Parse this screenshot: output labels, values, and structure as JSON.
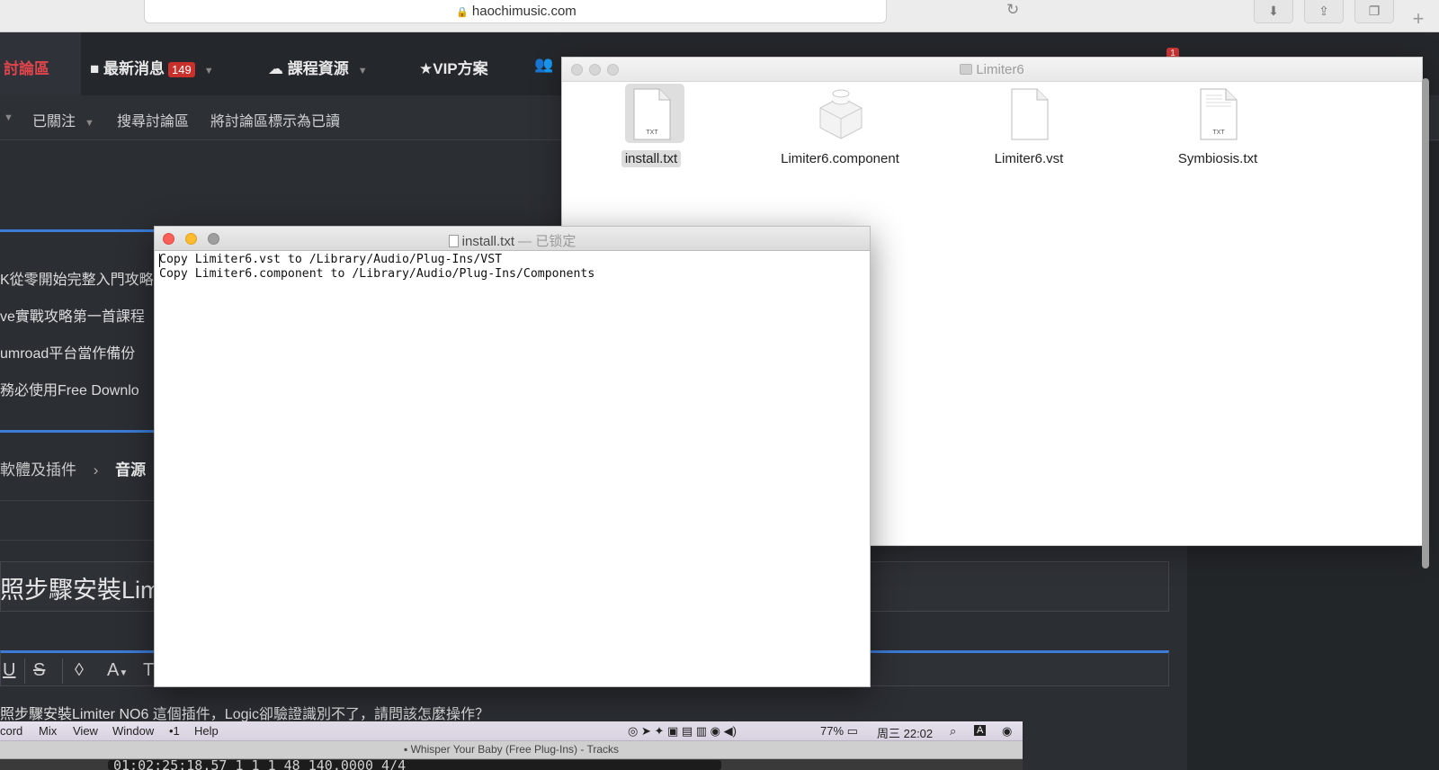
{
  "browser": {
    "url": "haochimusic.com",
    "lock_icon": "lock-icon",
    "reload_icon": "reload-icon",
    "toolbar_icons": [
      "download-icon",
      "share-icon",
      "tabs-overview-icon",
      "new-tab-icon"
    ],
    "new_tab_label": "+"
  },
  "site_nav": {
    "items": [
      {
        "label": "討論區",
        "icon": ""
      },
      {
        "label": "最新消息",
        "icon": "alert-icon",
        "badge": "149"
      },
      {
        "label": "課程資源",
        "icon": "cloud-download-icon"
      },
      {
        "label": "VIP方案",
        "icon": "star-icon"
      }
    ],
    "notification_badge": "1"
  },
  "sub_nav": {
    "items": [
      "已關注",
      "搜尋討論區",
      "將討論區標示為已讀"
    ]
  },
  "threads": [
    "K從零開始完整入門攻略",
    "ve實戰攻略第一首課程",
    "umroad平台當作備份",
    "務必使用Free Downlo"
  ],
  "breadcrumb": {
    "parent": "軟體及插件",
    "separator": "›",
    "current": "音源"
  },
  "post": {
    "title": "照步驟安裝Lim",
    "question": "照步驟安裝Limiter NO6 這個插件，Logic卻驗證識別不了，請問該怎麼操作？"
  },
  "editor_toolbar": [
    "U",
    "S",
    "◊",
    "A",
    "T"
  ],
  "finder": {
    "title": "Limiter6",
    "files": [
      {
        "name": "install.txt",
        "icon": "txt-file-icon",
        "selected": true
      },
      {
        "name": "Limiter6.component",
        "icon": "component-bundle-icon",
        "selected": false
      },
      {
        "name": "Limiter6.vst",
        "icon": "document-icon",
        "selected": false
      },
      {
        "name": "Symbiosis.txt",
        "icon": "txt-file-icon",
        "selected": false
      }
    ],
    "txt_badge": "TXT"
  },
  "textedit": {
    "title": "install.txt",
    "title_suffix": "— 已锁定",
    "lines": [
      "Copy Limiter6.vst to /Library/Audio/Plug-Ins/VST",
      "Copy Limiter6.component to /Library/Audio/Plug-Ins/Components"
    ]
  },
  "mac_menubar": {
    "items": [
      "cord",
      "Mix",
      "View",
      "Window",
      "•1",
      "Help"
    ],
    "battery": "77%",
    "clock": "周三 22:02",
    "input_source": "A"
  },
  "logic": {
    "window_title": "Whisper Your Baby (Free Plug-Ins) - Tracks",
    "lcd": "01:02:25:18.57   1 1 1   48   140.0000   4/4"
  },
  "colors": {
    "accent_red": "#e0454b",
    "badge_red": "#c9302c",
    "accent_blue": "#3c7bd6",
    "close_red": "#fc5f57",
    "minimize_yellow": "#fdbc2e"
  }
}
